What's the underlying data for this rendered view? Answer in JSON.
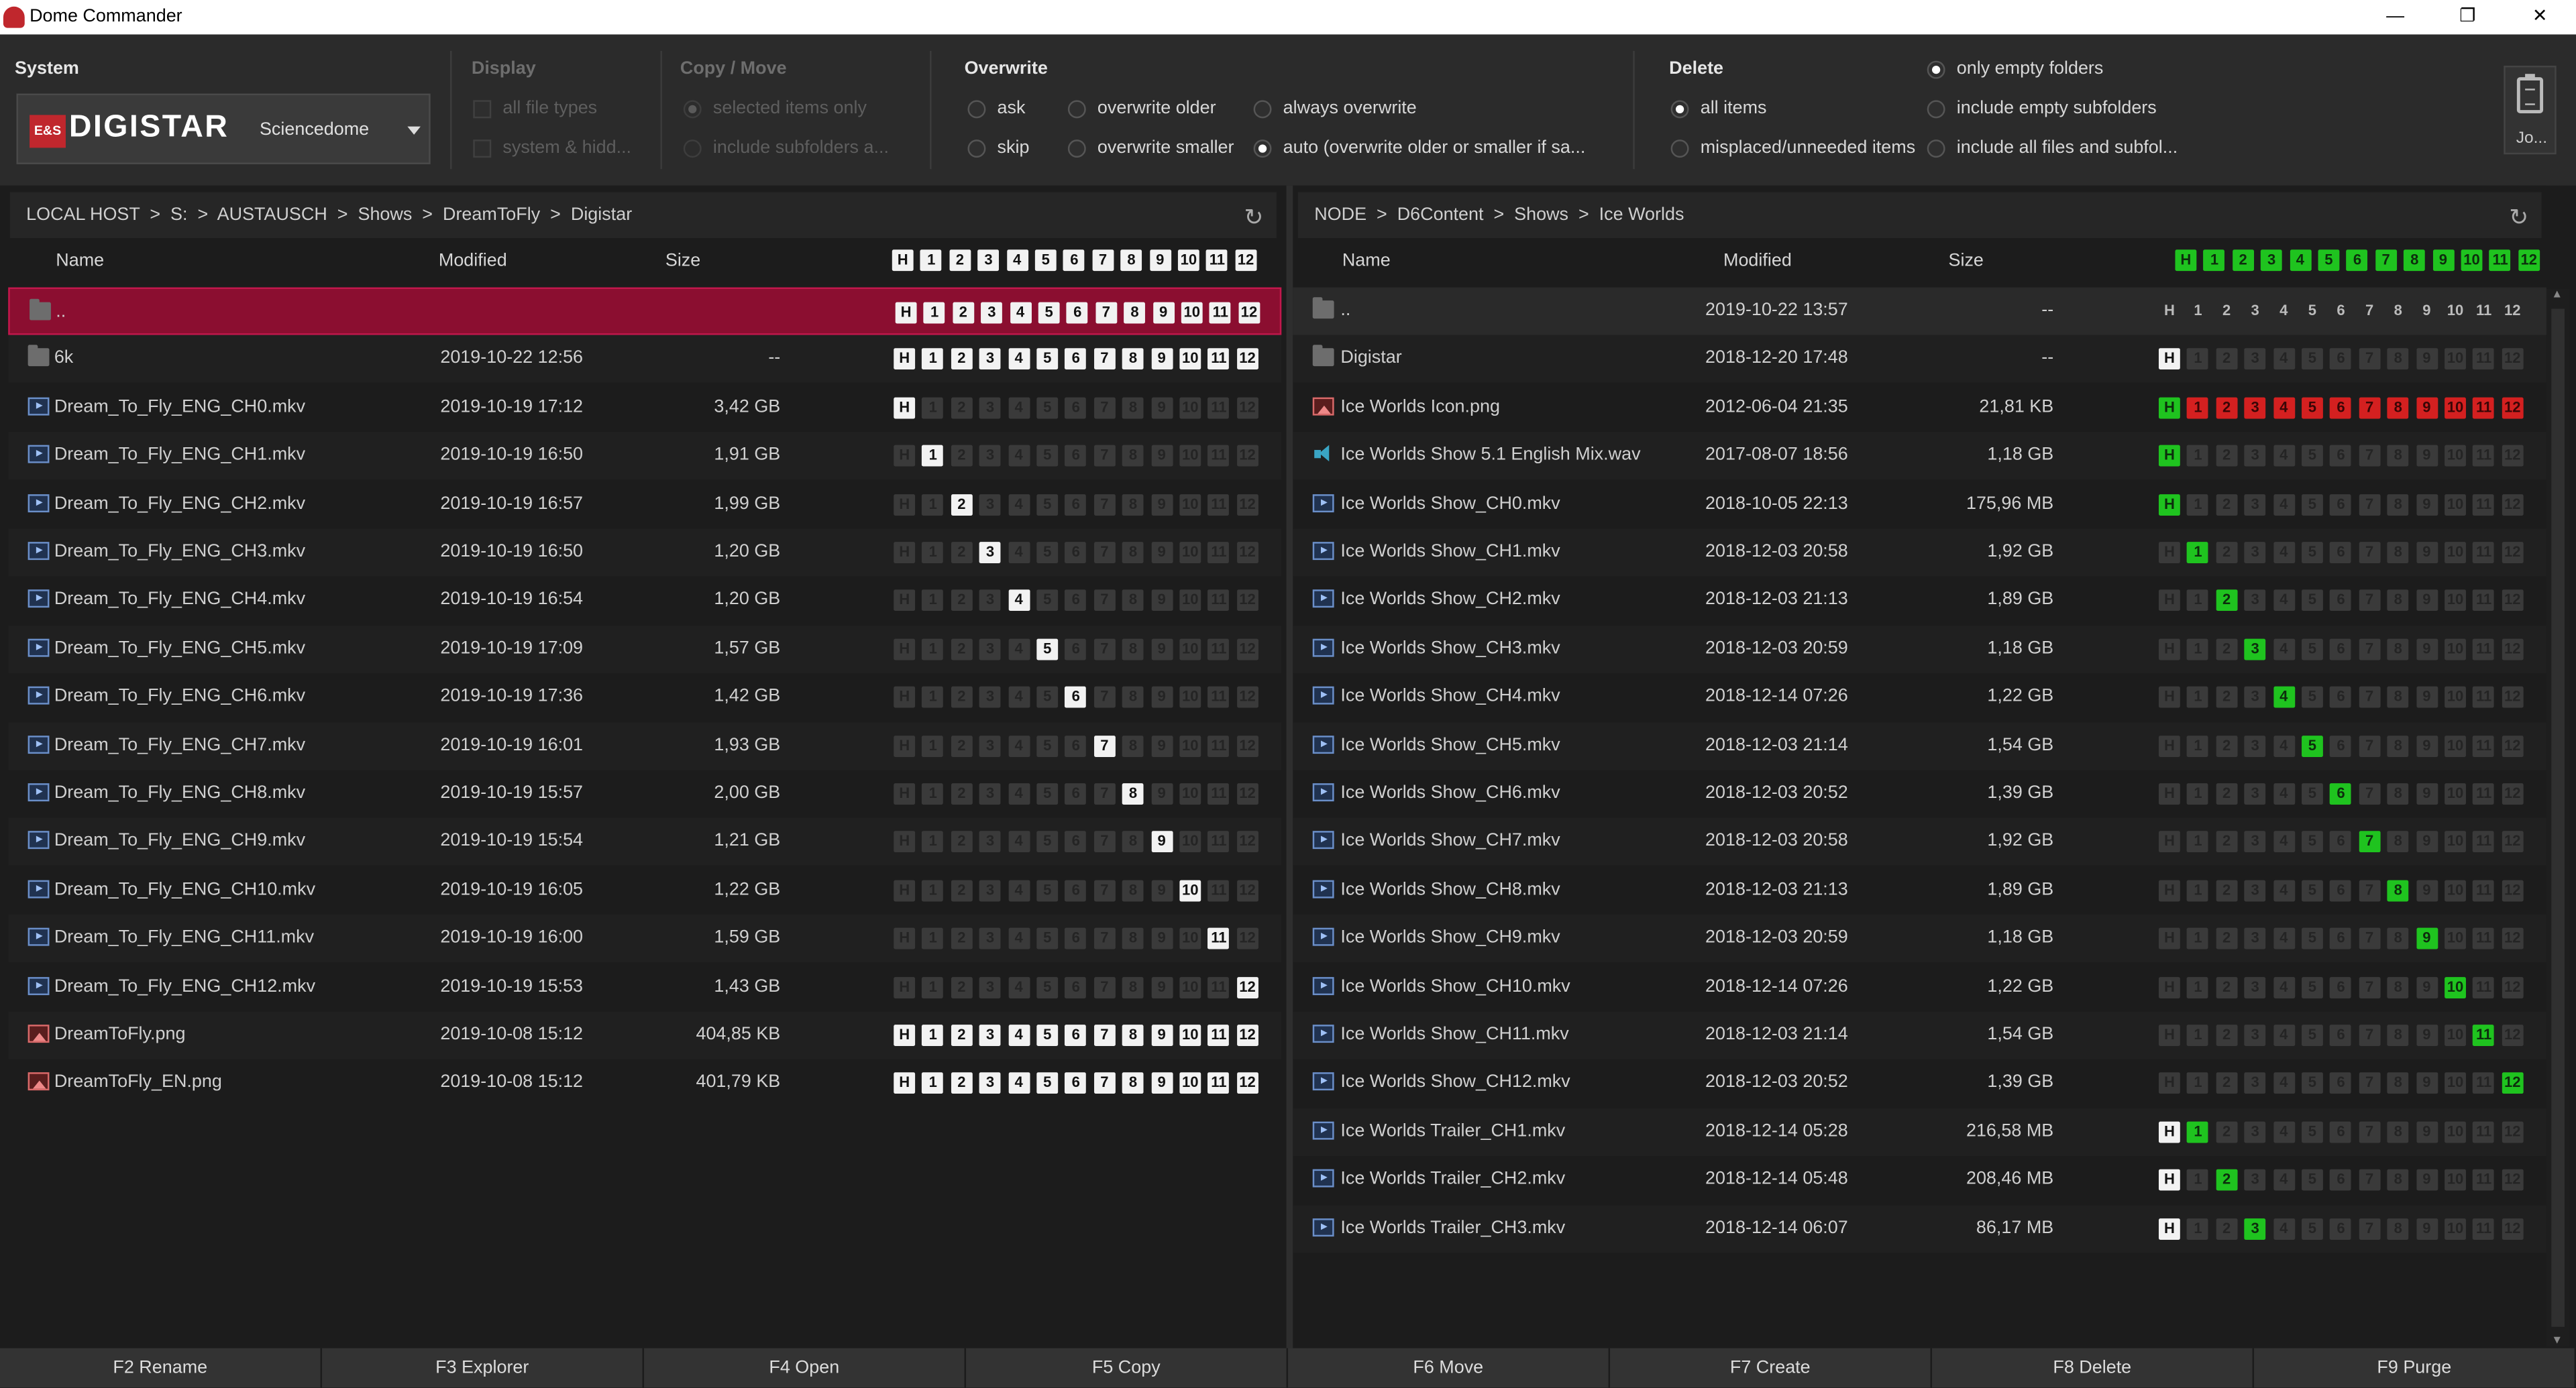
{
  "window": {
    "title": "Dome Commander",
    "min": "—",
    "max": "❐",
    "close": "✕"
  },
  "system": {
    "title": "System",
    "brand": "DIGISTAR",
    "logo_text": "E&S",
    "selected": "Sciencedome"
  },
  "display": {
    "title": "Display",
    "opt1": "all file types",
    "opt2": "system & hidd..."
  },
  "copymove": {
    "title": "Copy / Move",
    "opt1": "selected items only",
    "opt2": "include subfolders a..."
  },
  "overwrite": {
    "title": "Overwrite",
    "ask": "ask",
    "skip": "skip",
    "older": "overwrite older",
    "smaller": "overwrite smaller",
    "always": "always overwrite",
    "auto": "auto (overwrite older or smaller if sa...",
    "selected": "auto"
  },
  "delete": {
    "title": "Delete",
    "all": "all items",
    "misplaced": "misplaced/unneeded items",
    "empty": "only empty folders",
    "subempty": "include empty subfolders",
    "allfiles": "include all files and subfol...",
    "selected": [
      "all items",
      "only empty folders"
    ]
  },
  "jobs": {
    "label": "Jo..."
  },
  "left": {
    "path": "LOCAL HOST  >  S:  >  AUSTAUSCH  >  Shows  >  DreamToFly  >  Digistar",
    "refresh_icon": "refresh-icon",
    "headers": {
      "name": "Name",
      "modified": "Modified",
      "size": "Size"
    },
    "channels": [
      "H",
      "1",
      "2",
      "3",
      "4",
      "5",
      "6",
      "7",
      "8",
      "9",
      "10",
      "11",
      "12"
    ],
    "header_ch": "wwwwwwwwwwwww",
    "rows": [
      {
        "name": "..",
        "icon": "folder",
        "date": "",
        "size": "",
        "ch": "wwwwwwwwwwwww",
        "sel": true
      },
      {
        "name": "6k",
        "icon": "folder",
        "date": "2019-10-22  12:56",
        "size": "--",
        "ch": "wwwwwwwwwwwww"
      },
      {
        "name": "Dream_To_Fly_ENG_CH0.mkv",
        "icon": "video",
        "date": "2019-10-19  17:12",
        "size": "3,42 GB",
        "ch": "wdddddddddddd"
      },
      {
        "name": "Dream_To_Fly_ENG_CH1.mkv",
        "icon": "video",
        "date": "2019-10-19  16:50",
        "size": "1,91 GB",
        "ch": "dwddddddddddd"
      },
      {
        "name": "Dream_To_Fly_ENG_CH2.mkv",
        "icon": "video",
        "date": "2019-10-19  16:57",
        "size": "1,99 GB",
        "ch": "ddwdddddddddd"
      },
      {
        "name": "Dream_To_Fly_ENG_CH3.mkv",
        "icon": "video",
        "date": "2019-10-19  16:50",
        "size": "1,20 GB",
        "ch": "dddwddddddddd"
      },
      {
        "name": "Dream_To_Fly_ENG_CH4.mkv",
        "icon": "video",
        "date": "2019-10-19  16:54",
        "size": "1,20 GB",
        "ch": "ddddwdddddddd"
      },
      {
        "name": "Dream_To_Fly_ENG_CH5.mkv",
        "icon": "video",
        "date": "2019-10-19  17:09",
        "size": "1,57 GB",
        "ch": "dddddwddddddd"
      },
      {
        "name": "Dream_To_Fly_ENG_CH6.mkv",
        "icon": "video",
        "date": "2019-10-19  17:36",
        "size": "1,42 GB",
        "ch": "ddddddwdddddd"
      },
      {
        "name": "Dream_To_Fly_ENG_CH7.mkv",
        "icon": "video",
        "date": "2019-10-19  16:01",
        "size": "1,93 GB",
        "ch": "dddddddwddddd"
      },
      {
        "name": "Dream_To_Fly_ENG_CH8.mkv",
        "icon": "video",
        "date": "2019-10-19  15:57",
        "size": "2,00 GB",
        "ch": "ddddddddwdddd"
      },
      {
        "name": "Dream_To_Fly_ENG_CH9.mkv",
        "icon": "video",
        "date": "2019-10-19  15:54",
        "size": "1,21 GB",
        "ch": "dddddddddwddd"
      },
      {
        "name": "Dream_To_Fly_ENG_CH10.mkv",
        "icon": "video",
        "date": "2019-10-19  16:05",
        "size": "1,22 GB",
        "ch": "ddddddddddwdd"
      },
      {
        "name": "Dream_To_Fly_ENG_CH11.mkv",
        "icon": "video",
        "date": "2019-10-19  16:00",
        "size": "1,59 GB",
        "ch": "dddddddddddwd"
      },
      {
        "name": "Dream_To_Fly_ENG_CH12.mkv",
        "icon": "video",
        "date": "2019-10-19  15:53",
        "size": "1,43 GB",
        "ch": "ddddddddddddw"
      },
      {
        "name": "DreamToFly.png",
        "icon": "image",
        "date": "2019-10-08  15:12",
        "size": "404,85 KB",
        "ch": "wwwwwwwwwwwww"
      },
      {
        "name": "DreamToFly_EN.png",
        "icon": "image",
        "date": "2019-10-08  15:12",
        "size": "401,79 KB",
        "ch": "wwwwwwwwwwwww"
      }
    ]
  },
  "right": {
    "path": "NODE  >  D6Content  >  Shows  >  Ice Worlds",
    "refresh_icon": "refresh-icon",
    "headers": {
      "name": "Name",
      "modified": "Modified",
      "size": "Size"
    },
    "header_ch": "ggggggggggggg",
    "rows": [
      {
        "name": "..",
        "icon": "folder",
        "date": "2019-10-22  13:57",
        "size": "--",
        "ch": "nnnnnnnnnnnnn",
        "sel": true
      },
      {
        "name": "Digistar",
        "icon": "folder",
        "date": "2018-12-20  17:48",
        "size": "--",
        "ch": "wdddddddddddd"
      },
      {
        "name": "Ice Worlds Icon.png",
        "icon": "image",
        "date": "2012-06-04  21:35",
        "size": "21,81 KB",
        "ch": "grrrrrrrrrrrr"
      },
      {
        "name": "Ice Worlds Show 5.1 English Mix.wav",
        "icon": "audio",
        "date": "2017-08-07  18:56",
        "size": "1,18 GB",
        "ch": "gdddddddddddd"
      },
      {
        "name": "Ice Worlds Show_CH0.mkv",
        "icon": "video",
        "date": "2018-10-05  22:13",
        "size": "175,96 MB",
        "ch": "gdddddddddddd"
      },
      {
        "name": "Ice Worlds Show_CH1.mkv",
        "icon": "video",
        "date": "2018-12-03  20:58",
        "size": "1,92 GB",
        "ch": "dgddddddddddd"
      },
      {
        "name": "Ice Worlds Show_CH2.mkv",
        "icon": "video",
        "date": "2018-12-03  21:13",
        "size": "1,89 GB",
        "ch": "ddgdddddddddd"
      },
      {
        "name": "Ice Worlds Show_CH3.mkv",
        "icon": "video",
        "date": "2018-12-03  20:59",
        "size": "1,18 GB",
        "ch": "dddgddddddddd"
      },
      {
        "name": "Ice Worlds Show_CH4.mkv",
        "icon": "video",
        "date": "2018-12-14  07:26",
        "size": "1,22 GB",
        "ch": "ddddgdddddddd"
      },
      {
        "name": "Ice Worlds Show_CH5.mkv",
        "icon": "video",
        "date": "2018-12-03  21:14",
        "size": "1,54 GB",
        "ch": "dddddgddddddd"
      },
      {
        "name": "Ice Worlds Show_CH6.mkv",
        "icon": "video",
        "date": "2018-12-03  20:52",
        "size": "1,39 GB",
        "ch": "ddddddgdddddd"
      },
      {
        "name": "Ice Worlds Show_CH7.mkv",
        "icon": "video",
        "date": "2018-12-03  20:58",
        "size": "1,92 GB",
        "ch": "dddddddgddddd"
      },
      {
        "name": "Ice Worlds Show_CH8.mkv",
        "icon": "video",
        "date": "2018-12-03  21:13",
        "size": "1,89 GB",
        "ch": "ddddddddgdddd"
      },
      {
        "name": "Ice Worlds Show_CH9.mkv",
        "icon": "video",
        "date": "2018-12-03  20:59",
        "size": "1,18 GB",
        "ch": "dddddddddgddd"
      },
      {
        "name": "Ice Worlds Show_CH10.mkv",
        "icon": "video",
        "date": "2018-12-14  07:26",
        "size": "1,22 GB",
        "ch": "ddddddddddgdd"
      },
      {
        "name": "Ice Worlds Show_CH11.mkv",
        "icon": "video",
        "date": "2018-12-03  21:14",
        "size": "1,54 GB",
        "ch": "dddddddddddgd"
      },
      {
        "name": "Ice Worlds Show_CH12.mkv",
        "icon": "video",
        "date": "2018-12-03  20:52",
        "size": "1,39 GB",
        "ch": "ddddddddddddg"
      },
      {
        "name": "Ice Worlds Trailer_CH1.mkv",
        "icon": "video",
        "date": "2018-12-14  05:28",
        "size": "216,58 MB",
        "ch": "wgddddddddddd"
      },
      {
        "name": "Ice Worlds Trailer_CH2.mkv",
        "icon": "video",
        "date": "2018-12-14  05:48",
        "size": "208,46 MB",
        "ch": "wdgdddddddddd"
      },
      {
        "name": "Ice Worlds Trailer_CH3.mkv",
        "icon": "video",
        "date": "2018-12-14  06:07",
        "size": "86,17 MB",
        "ch": "wddgddddddddd"
      }
    ]
  },
  "fkeys": [
    "F2 Rename",
    "F3 Explorer",
    "F4 Open",
    "F5 Copy",
    "F6 Move",
    "F7 Create",
    "F8 Delete",
    "F9 Purge"
  ],
  "colors": {
    "selection": "#8b0e30",
    "present": "#1fc31f",
    "missing": "#d42020",
    "background": "#1c1c1c"
  }
}
